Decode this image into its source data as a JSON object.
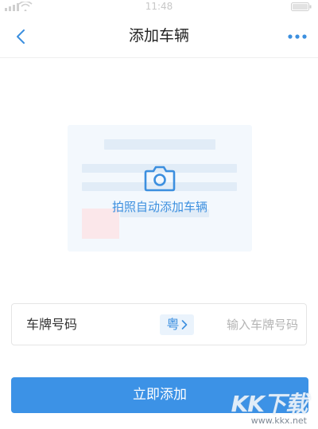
{
  "status_bar": {
    "time": "11:48"
  },
  "header": {
    "title": "添加车辆"
  },
  "photo_card": {
    "label": "拍照自动添加车辆"
  },
  "plate_form": {
    "label": "车牌号码",
    "province": "粤",
    "placeholder": "输入车牌号码"
  },
  "submit": {
    "label": "立即添加"
  },
  "watermark": {
    "logo": "KK下载",
    "url": "www.kkx.net"
  },
  "colors": {
    "accent": "#3c8fdf",
    "button": "#3c92e6"
  }
}
